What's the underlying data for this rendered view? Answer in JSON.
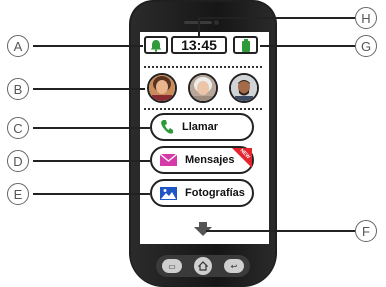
{
  "status_bar": {
    "time": "13:45",
    "bell_icon": "bell-icon",
    "battery_icon": "battery-icon"
  },
  "contacts": [
    {
      "name": "contact-woman",
      "icon": "avatar"
    },
    {
      "name": "contact-elder",
      "icon": "avatar"
    },
    {
      "name": "contact-man",
      "icon": "avatar"
    }
  ],
  "buttons": {
    "call": "Llamar",
    "messages": "Mensajes",
    "messages_badge": "NEW",
    "photos": "Fotografías"
  },
  "callouts": [
    "A",
    "B",
    "C",
    "D",
    "E",
    "F",
    "G",
    "H"
  ],
  "hardware": {
    "menu_glyph": "▭",
    "back_glyph": "↩"
  },
  "colors": {
    "green": "#2e9a3a",
    "magenta": "#d63aa8",
    "blue": "#1f56c6",
    "badge_red": "#e3262e"
  }
}
